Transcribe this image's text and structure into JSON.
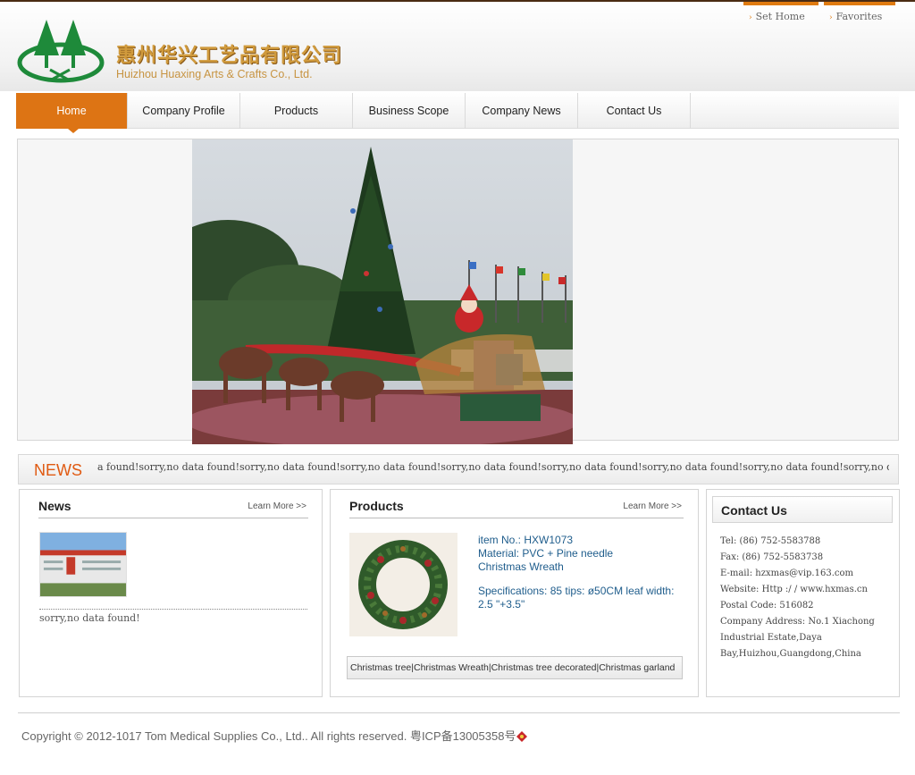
{
  "header": {
    "brand_cn": "惠州华兴工艺品有限公司",
    "brand_en": "Huizhou Huaxing Arts & Crafts Co., Ltd.",
    "top_links": [
      {
        "label": "Set Home",
        "icon": "arrow-right-icon"
      },
      {
        "label": "Favorites",
        "icon": "arrow-right-icon"
      }
    ]
  },
  "nav": {
    "items": [
      {
        "label": "Home",
        "active": true
      },
      {
        "label": "Company Profile"
      },
      {
        "label": "Products"
      },
      {
        "label": "Business Scope"
      },
      {
        "label": "Company News"
      },
      {
        "label": "Contact Us"
      }
    ]
  },
  "news_bar": {
    "title": "NEWS",
    "ticker": "a found!sorry,no data found!sorry,no data found!sorry,no data found!sorry,no data found!sorry,no data found!sorry,no data found!sorry,no data found!sorry,no da"
  },
  "news_panel": {
    "title": "News",
    "more": "Learn More >>",
    "empty": "sorry,no data found!"
  },
  "products_panel": {
    "title": "Products",
    "more": "Learn More >>",
    "item_no": "item  No.: HXW1073",
    "material": "Material: PVC + Pine needle",
    "name": "Christmas Wreath",
    "specs": "Specifications:  85 tips: ø50CM leaf width: 2.5 \"+3.5\"",
    "links": [
      "Christmas tree",
      "Christmas Wreath",
      "Christmas tree decorated",
      "Christmas garland"
    ]
  },
  "contact_panel": {
    "title": "Contact Us",
    "lines": [
      "Tel: (86) 752-5583788",
      "Fax: (86) 752-5583738",
      "E-mail: hzxmas@vip.163.com",
      "Website: Http :/ / www.hxmas.cn",
      "Postal Code: 516082",
      "Company Address: No.1 Xiachong",
      "Industrial Estate,Daya",
      "Bay,Huizhou,Guangdong,China"
    ]
  },
  "footer": {
    "text": "Copyright © 2012-1017 Tom Medical Supplies Co., Ltd.. All rights reserved. 粤ICP备13005358号"
  },
  "colors": {
    "accent": "#dd7414",
    "news_title": "#e05a12",
    "brand_gold": "#d09a3c",
    "logo_green": "#1e8a3a",
    "product_text": "#1f5d8c"
  }
}
